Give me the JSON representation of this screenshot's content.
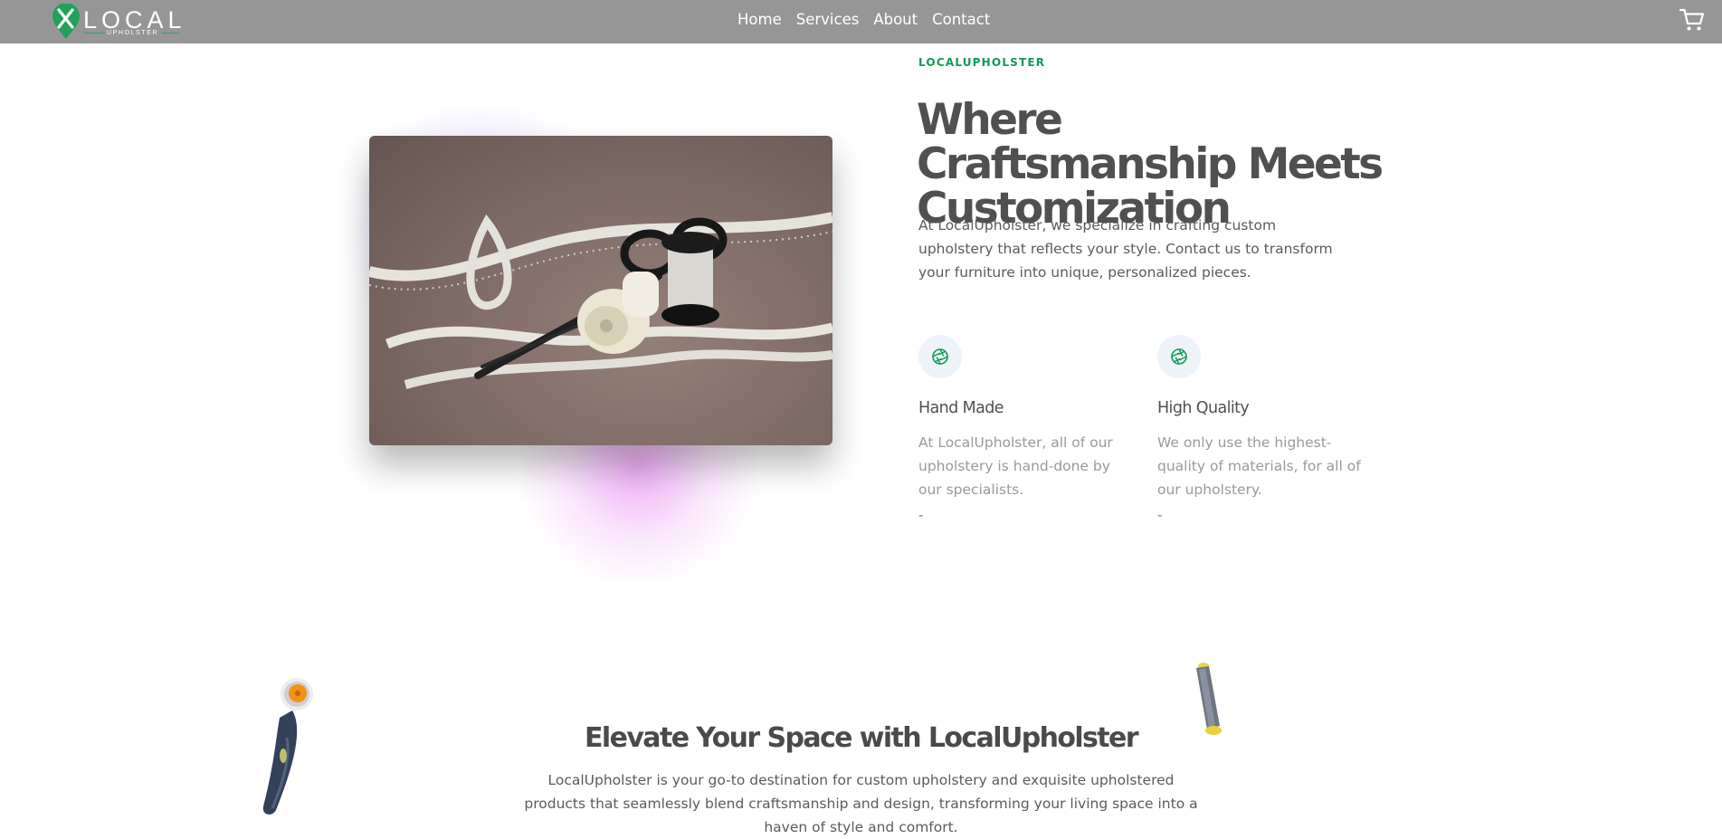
{
  "header": {
    "logo_text": "LOCAL",
    "logo_subtext": "UPHOLSTER",
    "nav": [
      {
        "label": "Home"
      },
      {
        "label": "Services"
      },
      {
        "label": "About"
      },
      {
        "label": "Contact"
      }
    ],
    "cart_icon": "shopping-cart-icon"
  },
  "hero": {
    "eyebrow": "LOCALUPHOLSTER",
    "title": "Where Craftsmanship Meets Customization",
    "text": "At LocalUpholster, we specialize in crafting custom upholstery that reflects your style. Contact us to transform your furniture into unique, personalized pieces.",
    "image": "tape-measure-scissors-thread-photo",
    "features": [
      {
        "icon": "aperture-icon",
        "title": "Hand Made",
        "text": "At LocalUpholster, all of our upholstery is hand-done by our specialists.",
        "dash": "-"
      },
      {
        "icon": "aperture-icon",
        "title": "High Quality",
        "text": "We only use the highest-quality of materials, for all of our upholstery.",
        "dash": "-"
      }
    ]
  },
  "section": {
    "title": "Elevate Your Space with LocalUpholster",
    "text": "LocalUpholster is your go-to destination for custom upholstery and exquisite upholstered products that seamlessly blend craftsmanship and design, transforming your living space into a haven of style and comfort."
  },
  "colors": {
    "header_bg": "#969696",
    "accent_green": "#129a53",
    "heading": "#505050",
    "muted_text": "#9a9a9a",
    "glow_pink": "#eba0f5",
    "glow_purple": "#ad8cff"
  }
}
